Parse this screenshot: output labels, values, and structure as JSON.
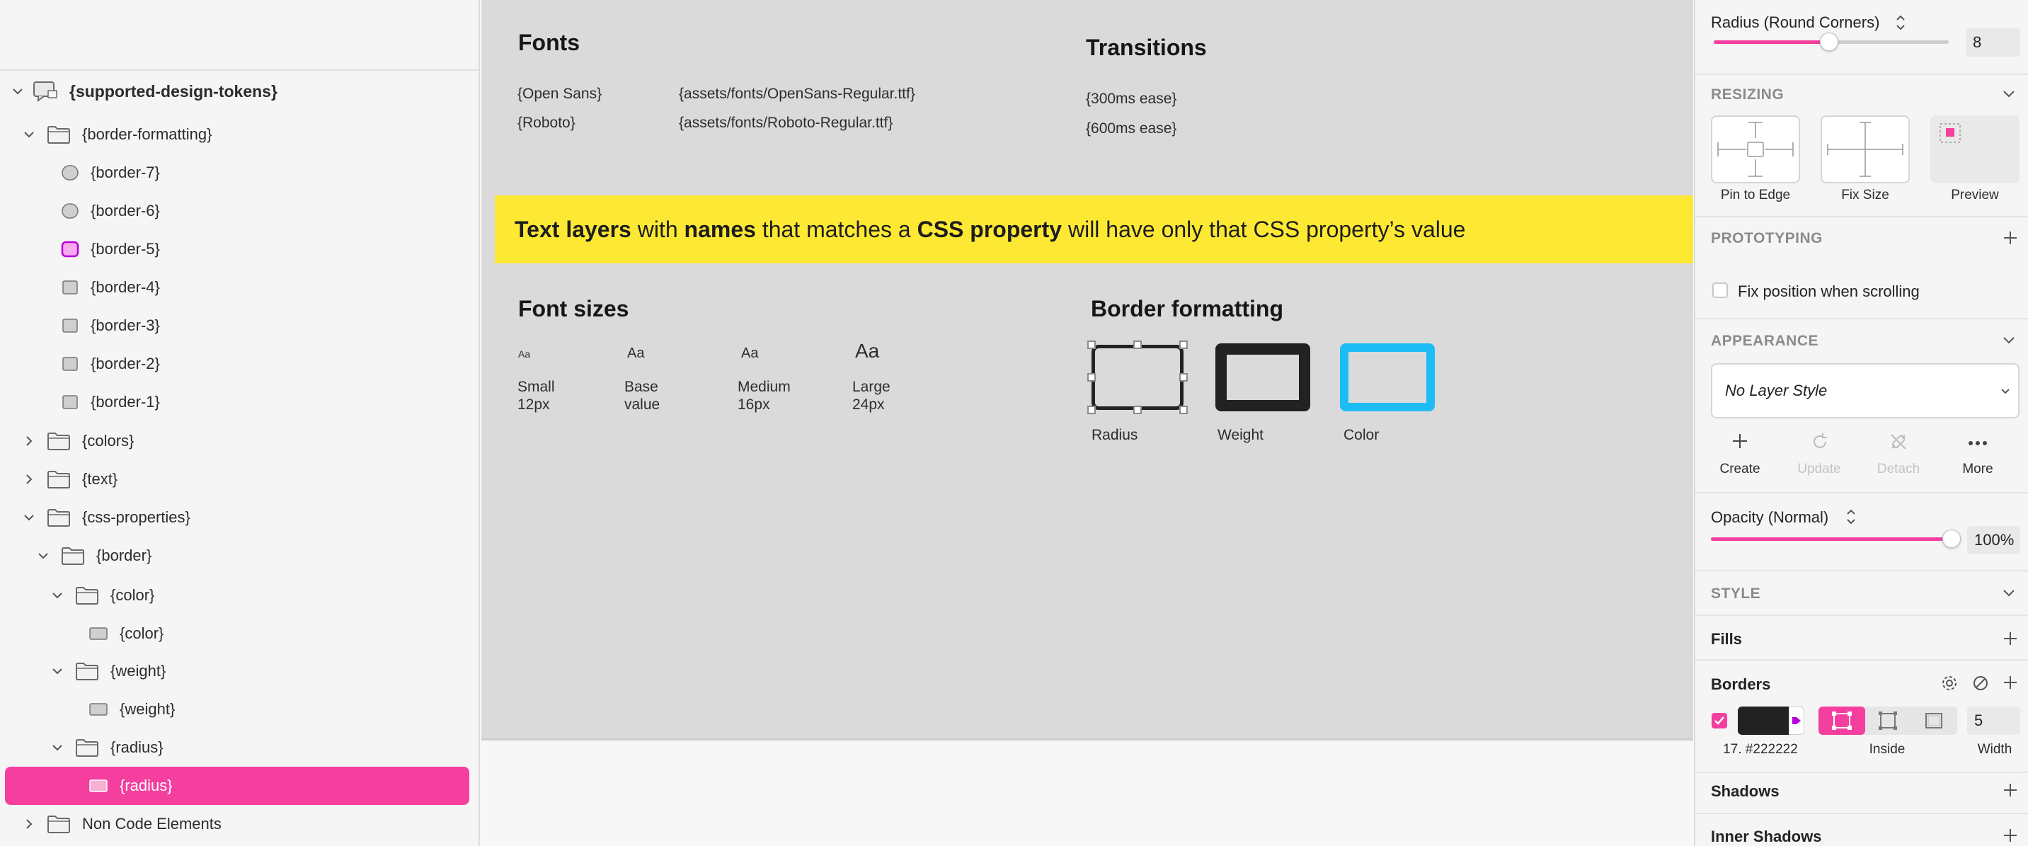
{
  "layers": {
    "root": "{supported-design-tokens}",
    "items": [
      {
        "label": "{border-formatting}",
        "kind": "folder",
        "expanded": true
      },
      {
        "label": "{border-7}",
        "kind": "circle"
      },
      {
        "label": "{border-6}",
        "kind": "circle"
      },
      {
        "label": "{border-5}",
        "kind": "pink-square"
      },
      {
        "label": "{border-4}",
        "kind": "square"
      },
      {
        "label": "{border-3}",
        "kind": "square"
      },
      {
        "label": "{border-2}",
        "kind": "square"
      },
      {
        "label": "{border-1}",
        "kind": "square"
      },
      {
        "label": "{colors}",
        "kind": "folder",
        "expanded": false
      },
      {
        "label": "{text}",
        "kind": "folder",
        "expanded": false
      },
      {
        "label": "{css-properties}",
        "kind": "folder",
        "expanded": true
      },
      {
        "label": "{border}",
        "kind": "folder",
        "expanded": true
      },
      {
        "label": "{color}",
        "kind": "folder",
        "expanded": true
      },
      {
        "label": "{color}",
        "kind": "rect"
      },
      {
        "label": "{weight}",
        "kind": "folder",
        "expanded": true
      },
      {
        "label": "{weight}",
        "kind": "rect"
      },
      {
        "label": "{radius}",
        "kind": "folder",
        "expanded": true
      },
      {
        "label": "{radius}",
        "kind": "rect",
        "selected": true
      },
      {
        "label": "Non Code Elements",
        "kind": "folder",
        "expanded": false
      }
    ]
  },
  "canvas": {
    "fonts": {
      "title": "Fonts",
      "rows": [
        {
          "name": "{Open Sans}",
          "path": "{assets/fonts/OpenSans-Regular.ttf}"
        },
        {
          "name": "{Roboto}",
          "path": "{assets/fonts/Roboto-Regular.ttf}"
        }
      ]
    },
    "transitions": {
      "title": "Transitions",
      "rows": [
        "{300ms ease}",
        "{600ms ease}"
      ]
    },
    "banner": {
      "p1": "Text layers",
      "p2": " with ",
      "p3": "names",
      "p4": " that matches a ",
      "p5": "CSS property",
      "p6": " will have only that CSS property’s value"
    },
    "font_sizes": {
      "title": "Font sizes",
      "sample": "Aa",
      "items": [
        {
          "line1": "Small",
          "line2": "12px"
        },
        {
          "line1": "Base",
          "line2": "value"
        },
        {
          "line1": "Medium",
          "line2": "16px"
        },
        {
          "line1": "Large",
          "line2": "24px"
        }
      ]
    },
    "border_formatting": {
      "title": "Border formatting",
      "items": [
        "Radius",
        "Weight",
        "Color"
      ],
      "color_accent": "#1ebcf5"
    }
  },
  "inspector": {
    "radius_label": "Radius (Round Corners)",
    "radius_value": "8",
    "radius_slider_fraction": 0.49,
    "resizing": {
      "title": "RESIZING",
      "tiles": [
        "Pin to Edge",
        "Fix Size",
        "Preview"
      ]
    },
    "prototyping": {
      "title": "PROTOTYPING",
      "fix_position": "Fix position when scrolling"
    },
    "appearance": {
      "title": "APPEARANCE",
      "layer_style": "No Layer Style",
      "actions": [
        "Create",
        "Update",
        "Detach",
        "More"
      ]
    },
    "opacity": {
      "label": "Opacity (Normal)",
      "value": "100%",
      "fraction": 1.0
    },
    "style_title": "STYLE",
    "fills": "Fills",
    "borders": {
      "title": "Borders",
      "color_label": "17. #222222",
      "position": "Inside",
      "width_value": "5",
      "width_label": "Width",
      "swatch_color": "#222222"
    },
    "shadows": "Shadows",
    "inner_shadows": "Inner Shadows",
    "accent": "#f43f9f"
  }
}
